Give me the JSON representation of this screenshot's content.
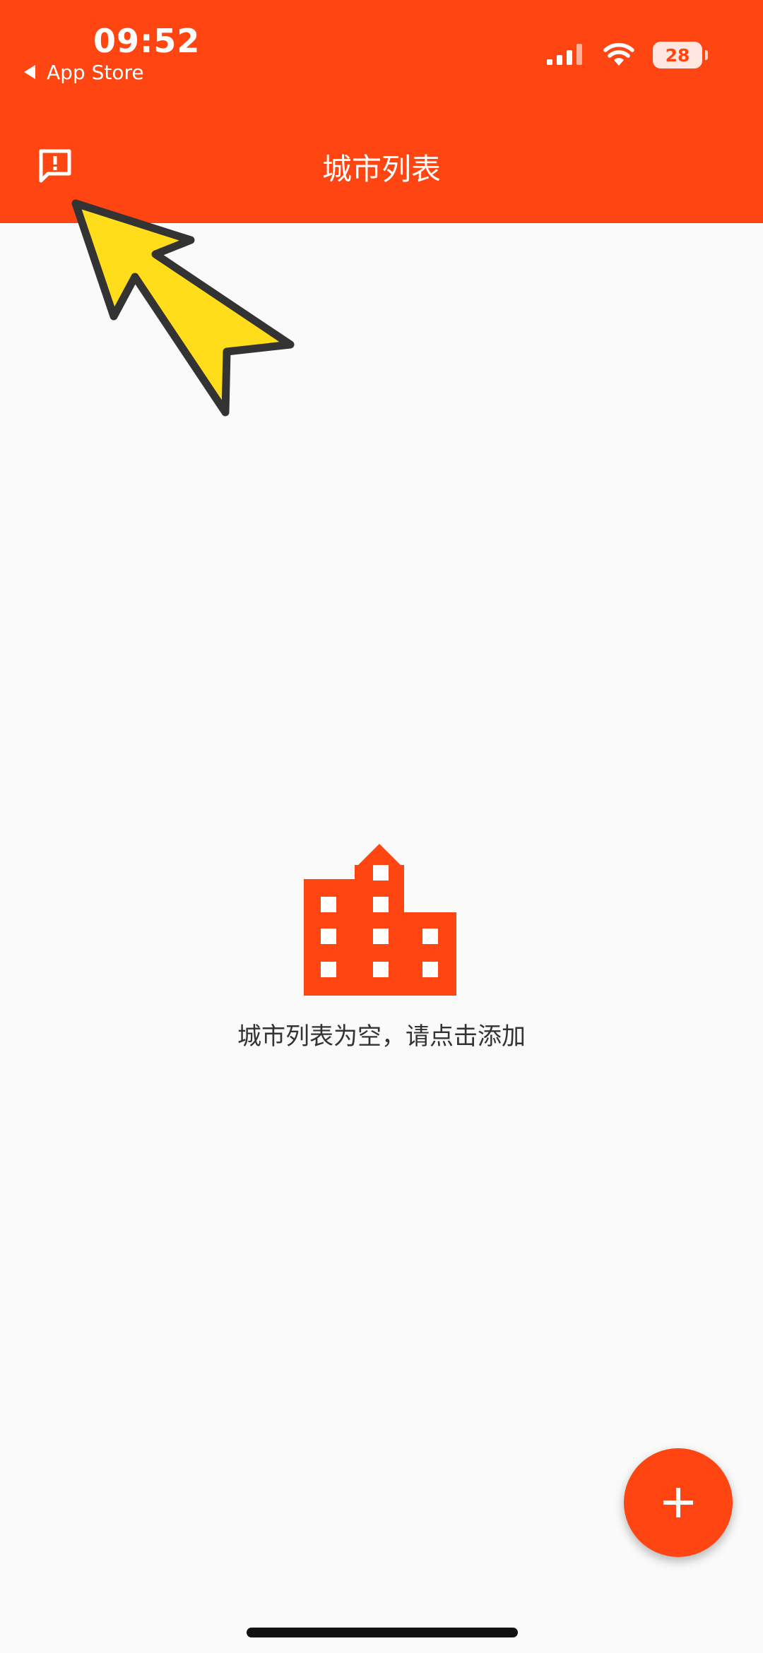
{
  "status_bar": {
    "time": "09:52",
    "back_app": "App Store",
    "battery": "28"
  },
  "app_bar": {
    "title": "城市列表",
    "leading_icon": "feedback-icon"
  },
  "empty_state": {
    "icon": "building-icon",
    "message": "城市列表为空，请点击添加"
  },
  "fab": {
    "icon": "plus-icon"
  },
  "annotation": {
    "icon": "pointer-arrow",
    "color": "#ffdd1a"
  },
  "colors": {
    "primary": "#fe4512",
    "background": "#fafafa",
    "text": "#333333"
  }
}
